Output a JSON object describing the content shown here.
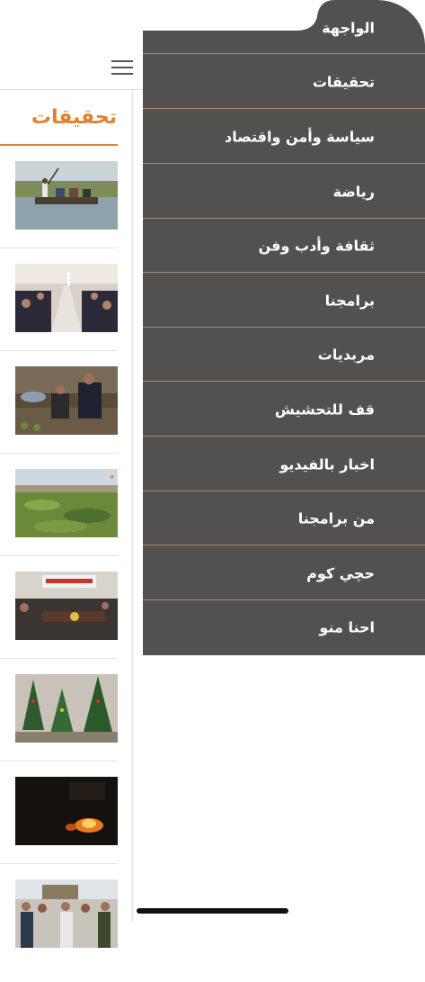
{
  "menu": {
    "items": [
      {
        "label": "الواجهة"
      },
      {
        "label": "تحقيقات"
      },
      {
        "label": "سياسة وأمن واقتصاد"
      },
      {
        "label": "رياضة"
      },
      {
        "label": "ثقافة وأدب وفن"
      },
      {
        "label": "برامجنا"
      },
      {
        "label": "مربديات"
      },
      {
        "label": "قف للتحشيش"
      },
      {
        "label": "اخبار بالفيديو"
      },
      {
        "label": "من برامجنا"
      },
      {
        "label": "حچي كوم"
      },
      {
        "label": "احنا منو"
      }
    ]
  },
  "content": {
    "section_title": "تحقيقات",
    "articles": [
      {
        "image": "boat-on-river"
      },
      {
        "image": "conference-table"
      },
      {
        "image": "people-by-fire"
      },
      {
        "image": "green-field-landscape"
      },
      {
        "image": "meeting-room"
      },
      {
        "image": "christmas-trees"
      },
      {
        "image": "fire-at-night"
      },
      {
        "image": "crowd-outdoors"
      }
    ]
  },
  "colors": {
    "drawer_bg": "#535050",
    "divider": "#a98a72",
    "accent": "#e57f2e"
  }
}
